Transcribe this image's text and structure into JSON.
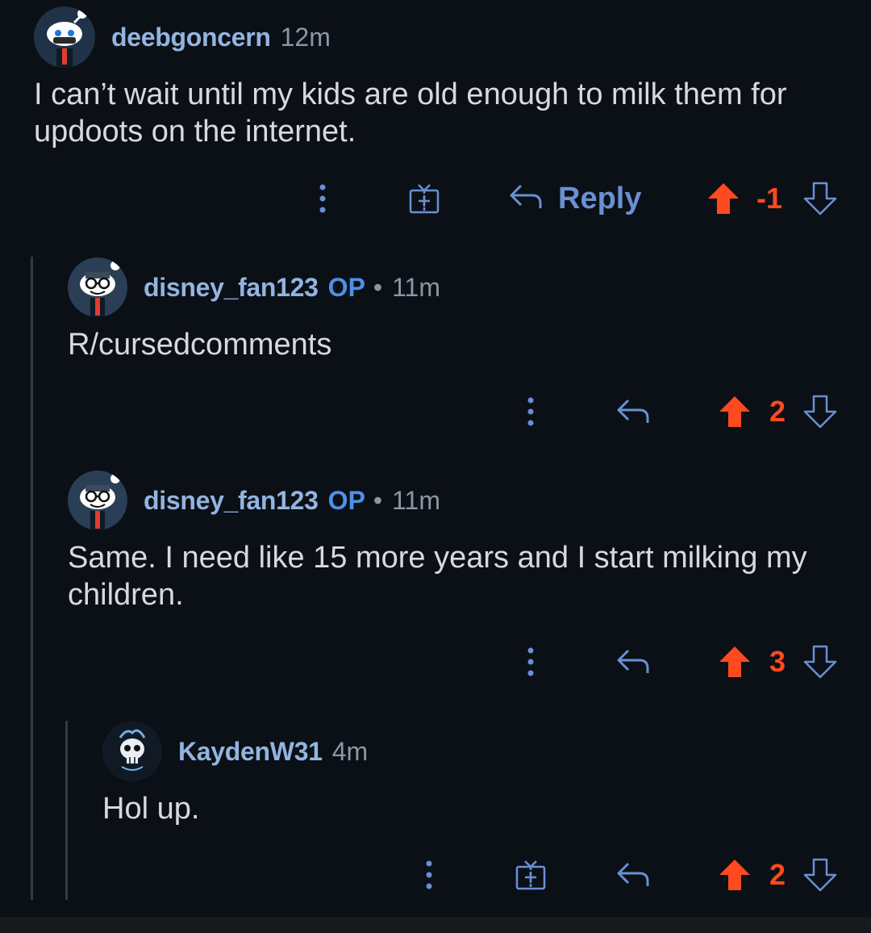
{
  "comments": [
    {
      "username": "deebgoncern",
      "op": "",
      "separator": "",
      "time": "12m",
      "body": "I can’t wait until my kids are old enough to milk them for updoots on the internet.",
      "reply_label": "Reply",
      "score": "-1",
      "avatar_icon": "snoo-avatar-icon"
    },
    {
      "username": "disney_fan123",
      "op": "OP",
      "separator": "•",
      "time": "11m",
      "body": "R/cursedcomments",
      "reply_label": "",
      "score": "2",
      "avatar_icon": "snoo-glasses-avatar-icon"
    },
    {
      "username": "disney_fan123",
      "op": "OP",
      "separator": "•",
      "time": "11m",
      "body": "Same. I need like 15 more years and I start milking my children.",
      "reply_label": "",
      "score": "3",
      "avatar_icon": "snoo-glasses-avatar-icon"
    },
    {
      "username": "KaydenW31",
      "op": "",
      "separator": "",
      "time": "4m",
      "body": "Hol up.",
      "reply_label": "",
      "score": "2",
      "avatar_icon": "skull-avatar-icon"
    }
  ],
  "colors": {
    "background": "#0b1016",
    "username": "#93b4e0",
    "op_badge": "#4f8fe8",
    "upvote": "#ff4a1f",
    "icon": "#6a8fd4"
  }
}
